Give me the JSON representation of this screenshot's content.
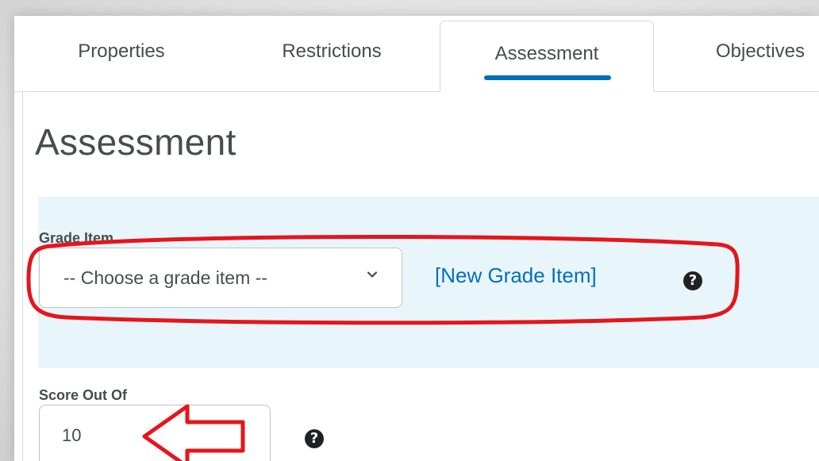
{
  "tabs": [
    {
      "label": "Properties",
      "selected": false
    },
    {
      "label": "Restrictions",
      "selected": false
    },
    {
      "label": "Assessment",
      "selected": true
    },
    {
      "label": "Objectives",
      "selected": false
    }
  ],
  "page_title": "Assessment",
  "grade_item": {
    "label": "Grade Item",
    "select_value": "-- Choose a grade item --",
    "new_link": "[New Grade Item]",
    "help_icon": "help-icon"
  },
  "score": {
    "label": "Score Out Of",
    "value": "10",
    "help_icon": "help-icon"
  },
  "colors": {
    "accent": "#006fbf",
    "section_bg": "#e8f6fc",
    "text": "#494c4e",
    "annotation": "#e8141b"
  },
  "icons": {
    "select_chevron": "chevron-down-icon",
    "help": "question-circle-icon"
  }
}
